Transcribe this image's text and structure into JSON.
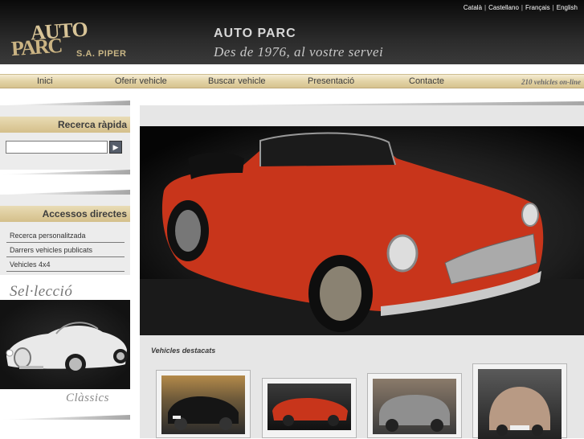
{
  "header": {
    "languages": [
      "Català",
      "Castellano",
      "Français",
      "English"
    ],
    "logo_top": "AUTO",
    "logo_bottom": "PARC",
    "logo_sub": "S.A. PIPER",
    "brand_name": "AUTO PARC",
    "slogan": "Des de 1976, al vostre servei"
  },
  "nav": {
    "items": [
      "Inici",
      "Oferir vehicle",
      "Buscar vehicle",
      "Presentació",
      "Contacte"
    ],
    "online": "210 vehicles on-line"
  },
  "sidebar": {
    "quick_search_title": "Recerca ràpida",
    "search_value": "",
    "search_button_icon": "arrow-right-icon",
    "access_title": "Accessos directes",
    "access_links": [
      "Recerca personalitzada",
      "Darrers vehicles publicats",
      "Vehicles 4x4"
    ],
    "selection_title": "Sel·lecció",
    "classics_label": "Clàssics"
  },
  "main": {
    "featured_title": "Vehicles destacats"
  },
  "colors": {
    "accent_gold": "#d6c28e",
    "header_dark": "#1a1a1a",
    "car_red": "#c8351b"
  }
}
